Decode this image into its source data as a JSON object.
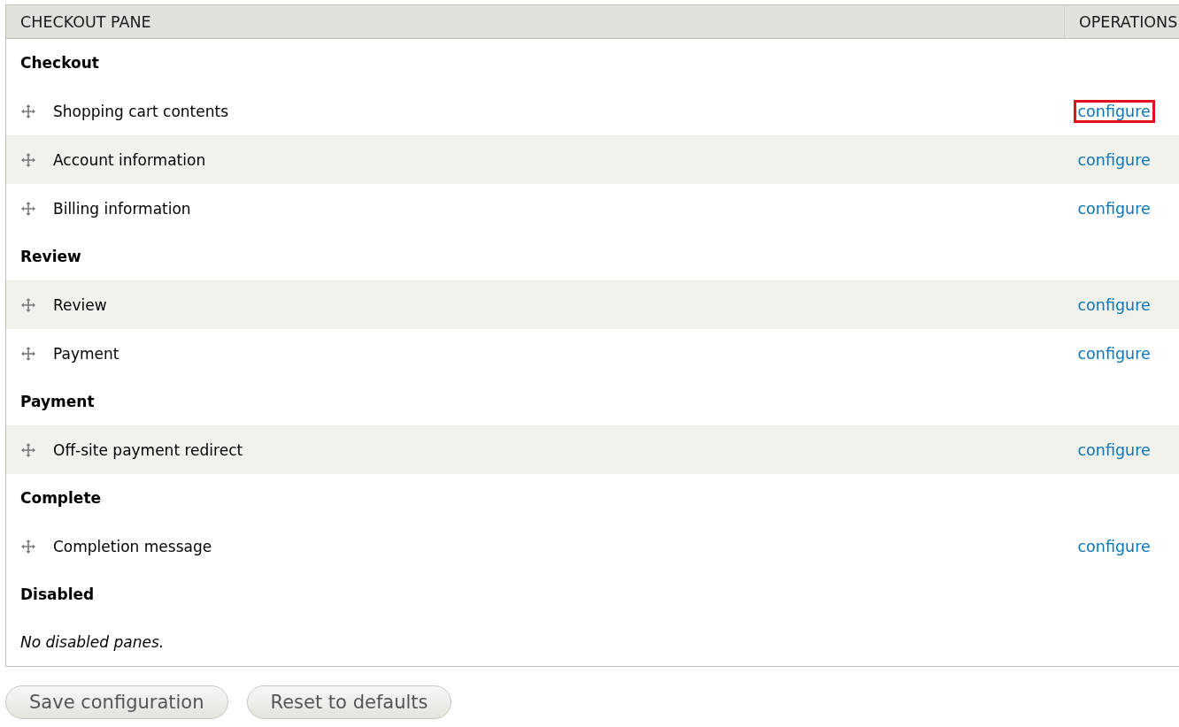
{
  "table": {
    "columns": [
      "CHECKOUT PANE",
      "OPERATIONS"
    ],
    "regions": [
      {
        "title": "Checkout",
        "panes": [
          {
            "label": "Shopping cart contents",
            "operation": "configure",
            "striped": false,
            "highlighted": true
          },
          {
            "label": "Account information",
            "operation": "configure",
            "striped": true,
            "highlighted": false
          },
          {
            "label": "Billing information",
            "operation": "configure",
            "striped": false,
            "highlighted": false
          }
        ]
      },
      {
        "title": "Review",
        "panes": [
          {
            "label": "Review",
            "operation": "configure",
            "striped": true,
            "highlighted": false
          },
          {
            "label": "Payment",
            "operation": "configure",
            "striped": false,
            "highlighted": false
          }
        ]
      },
      {
        "title": "Payment",
        "panes": [
          {
            "label": "Off-site payment redirect",
            "operation": "configure",
            "striped": true,
            "highlighted": false
          }
        ]
      },
      {
        "title": "Complete",
        "panes": [
          {
            "label": "Completion message",
            "operation": "configure",
            "striped": false,
            "highlighted": false
          }
        ]
      },
      {
        "title": "Disabled",
        "empty_message": "No disabled panes."
      }
    ]
  },
  "buttons": [
    "Save configuration",
    "Reset to defaults"
  ]
}
